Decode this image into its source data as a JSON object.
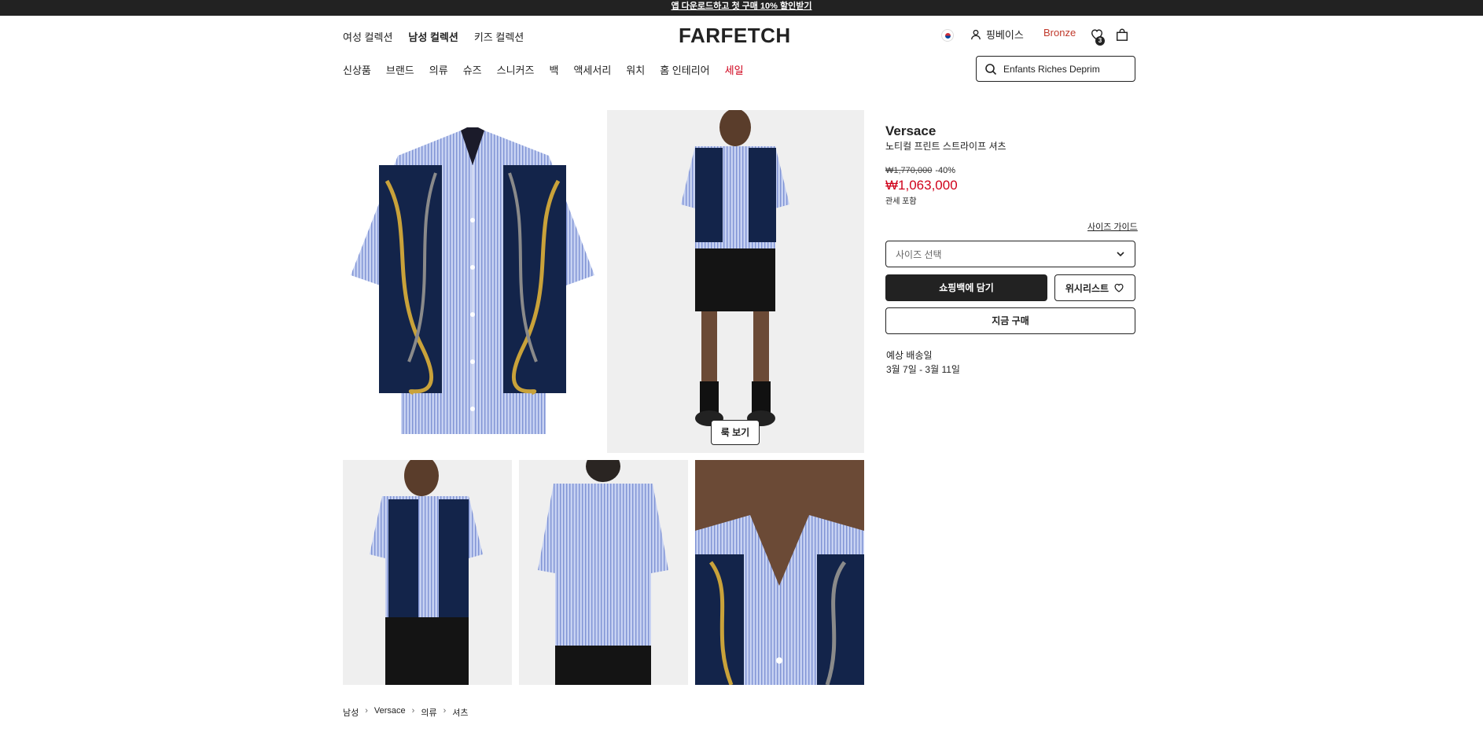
{
  "promo": {
    "text": "앱 다운로드하고 첫 구매 10% 할인받기"
  },
  "header": {
    "gender_tabs": [
      {
        "label": "여성 컬렉션"
      },
      {
        "label": "남성 컬렉션",
        "active": true
      },
      {
        "label": "키즈 컬렉션"
      }
    ],
    "logo": "FARFETCH",
    "user_name": "핑베이스",
    "tier": "Bronze",
    "wishlist_count": "3",
    "categories": [
      {
        "label": "신상품"
      },
      {
        "label": "브랜드"
      },
      {
        "label": "의류"
      },
      {
        "label": "슈즈"
      },
      {
        "label": "스니커즈"
      },
      {
        "label": "백"
      },
      {
        "label": "액세서리"
      },
      {
        "label": "워치"
      },
      {
        "label": "홈 인테리어"
      },
      {
        "label": "세일"
      }
    ],
    "search_value": "Enfants Riches Deprim"
  },
  "gallery": {
    "look_button": "룩 보기"
  },
  "breadcrumb": [
    "남성",
    "Versace",
    "의류",
    "셔츠"
  ],
  "product": {
    "brand": "Versace",
    "name": "노티컬 프린트 스트라이프 셔츠",
    "original_price": "₩1,770,000",
    "discount": "-40%",
    "price": "₩1,063,000",
    "duty_note": "관세 포함",
    "size_guide": "사이즈 가이드",
    "size_placeholder": "사이즈 선택",
    "add_to_bag": "쇼핑백에 담기",
    "wishlist": "위시리스트",
    "buy_now": "지금 구매",
    "shipping_label": "예상 배송일",
    "shipping_date": "3월 7일 - 3월 11일"
  },
  "colors": {
    "text": "#222222",
    "sale": "#d0021b",
    "tier": "#c0392b",
    "shirt_stripe": "#a9b8e6",
    "panel_navy": "#12213f"
  }
}
